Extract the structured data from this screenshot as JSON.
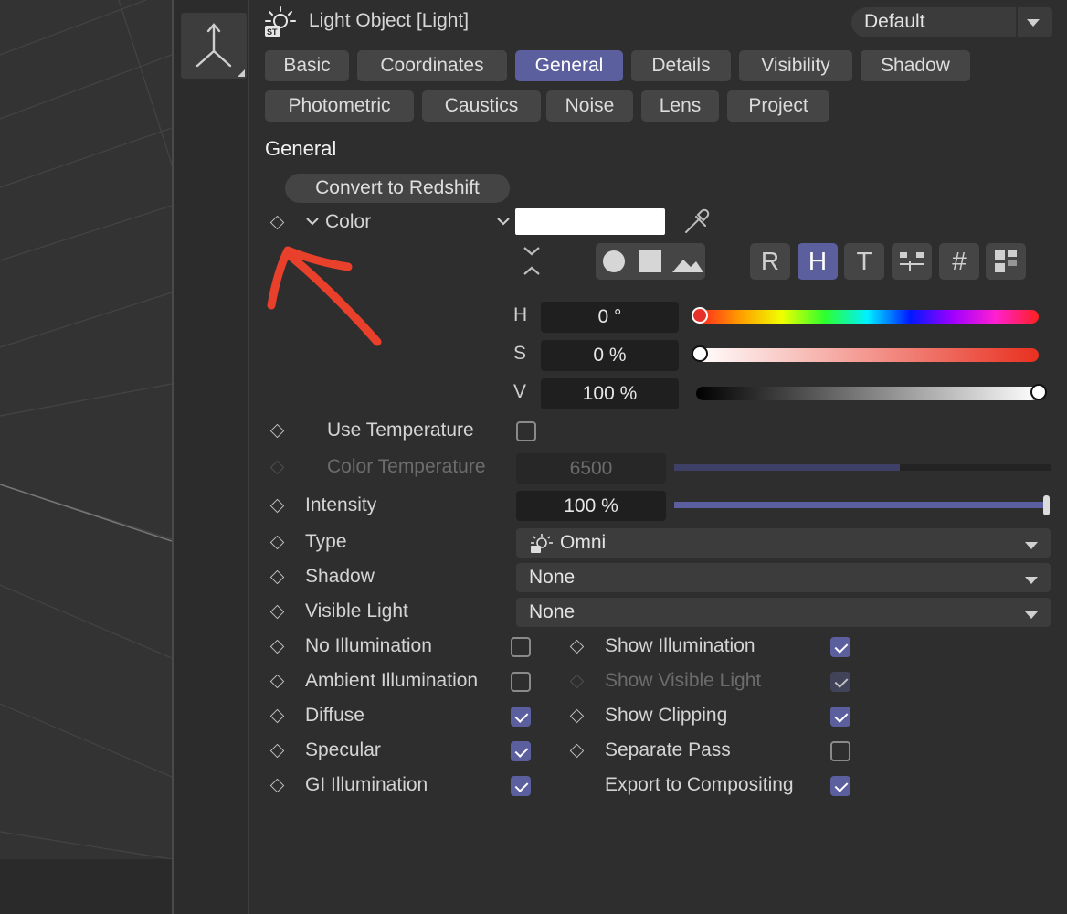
{
  "header": {
    "title": "Light Object [Light]",
    "title_icon": "light-bulb-icon",
    "preset": "Default"
  },
  "tabs_row1": [
    {
      "label": "Basic",
      "active": false
    },
    {
      "label": "Coordinates",
      "active": false
    },
    {
      "label": "General",
      "active": true
    },
    {
      "label": "Details",
      "active": false
    },
    {
      "label": "Visibility",
      "active": false
    },
    {
      "label": "Shadow",
      "active": false
    }
  ],
  "tabs_row2": [
    {
      "label": "Photometric",
      "active": false
    },
    {
      "label": "Caustics",
      "active": false
    },
    {
      "label": "Noise",
      "active": false
    },
    {
      "label": "Lens",
      "active": false
    },
    {
      "label": "Project",
      "active": false
    }
  ],
  "section_title": "General",
  "convert_button": "Convert to Redshift",
  "color": {
    "label": "Color",
    "swatch": "#ffffff",
    "mode_buttons": [
      "R",
      "H",
      "T",
      "#"
    ],
    "active_mode": "H",
    "hsv": [
      {
        "label": "H",
        "value": "0 °",
        "slider_level": 0.0
      },
      {
        "label": "S",
        "value": "0 %",
        "slider_level": 0.0
      },
      {
        "label": "V",
        "value": "100 %",
        "slider_level": 1.0
      }
    ]
  },
  "use_temperature": {
    "label": "Use Temperature",
    "checked": false
  },
  "color_temperature": {
    "label": "Color Temperature",
    "value": "6500",
    "slider_level": 0.6,
    "enabled": false
  },
  "intensity": {
    "label": "Intensity",
    "value": "100 %",
    "slider_level": 1.0
  },
  "dropdowns": [
    {
      "label": "Type",
      "value": "Omni",
      "icon": "omni-light-icon"
    },
    {
      "label": "Shadow",
      "value": "None"
    },
    {
      "label": "Visible Light",
      "value": "None"
    }
  ],
  "checks_left": [
    {
      "label": "No Illumination",
      "checked": false
    },
    {
      "label": "Ambient Illumination",
      "checked": false
    },
    {
      "label": "Diffuse",
      "checked": true
    },
    {
      "label": "Specular",
      "checked": true
    },
    {
      "label": "GI Illumination",
      "checked": true
    }
  ],
  "checks_right": [
    {
      "label": "Show Illumination",
      "checked": true,
      "enabled": true
    },
    {
      "label": "Show Visible Light",
      "checked": true,
      "enabled": false
    },
    {
      "label": "Show Clipping",
      "checked": true,
      "enabled": true
    },
    {
      "label": "Separate Pass",
      "checked": false,
      "enabled": true
    },
    {
      "label": "Export to Compositing",
      "checked": true,
      "enabled": true
    }
  ],
  "colors": {
    "accent": "#5b5f9e",
    "annotation_arrow": "#e8402a"
  }
}
